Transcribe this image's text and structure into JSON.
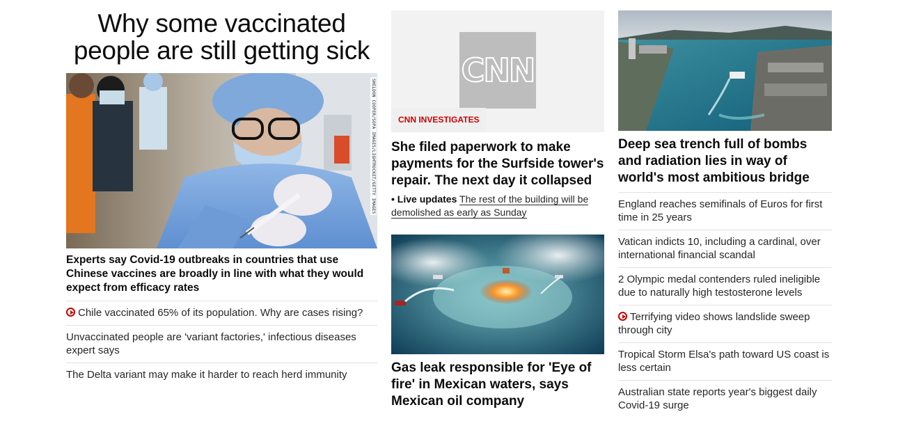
{
  "col1": {
    "main_headline": "Why some vaccinated people are still getting sick",
    "image_credit": "SHELDON COOPER/SOPA IMAGES/LIGHTROCKET/GETTY IMAGES",
    "lead_headline": "Experts say Covid-19 outbreaks in countries that use Chinese vaccines are broadly in line with what they would expect from efficacy rates",
    "related": [
      {
        "text": "Chile vaccinated 65% of its population. Why are cases rising?",
        "icon": "play-icon"
      },
      {
        "text": "Unvaccinated people are 'variant factories,' infectious diseases expert says"
      },
      {
        "text": "The Delta variant may make it harder to reach herd immunity"
      }
    ]
  },
  "col2": {
    "logo_text": "CNN",
    "badge": "CNN INVESTIGATES",
    "story1_headline": "She filed paperwork to make payments for the Surfside tower's repair. The next day it collapsed",
    "live_label": "• Live updates",
    "live_text": "The rest of the building will be demolished as early as Sunday",
    "story2_headline": "Gas leak responsible for 'Eye of fire' in Mexican waters, says Mexican oil company"
  },
  "col3": {
    "lead_headline": "Deep sea trench full of bombs and radiation lies in way of world's most ambitious bridge",
    "items": [
      {
        "text": "England reaches semifinals of Euros for first time in 25 years"
      },
      {
        "text": "Vatican indicts 10, including a cardinal, over international financial scandal"
      },
      {
        "text": "2 Olympic medal contenders ruled ineligible due to naturally high testosterone levels"
      },
      {
        "text": "Terrifying video shows landslide sweep through city",
        "icon": "play-icon"
      },
      {
        "text": "Tropical Storm Elsa's path toward US coast is less certain"
      },
      {
        "text": "Australian state reports year's biggest daily Covid-19 surge"
      }
    ]
  },
  "colors": {
    "accent": "#cc0000",
    "divider": "#e1e1e1",
    "text": "#0c0c0c"
  }
}
